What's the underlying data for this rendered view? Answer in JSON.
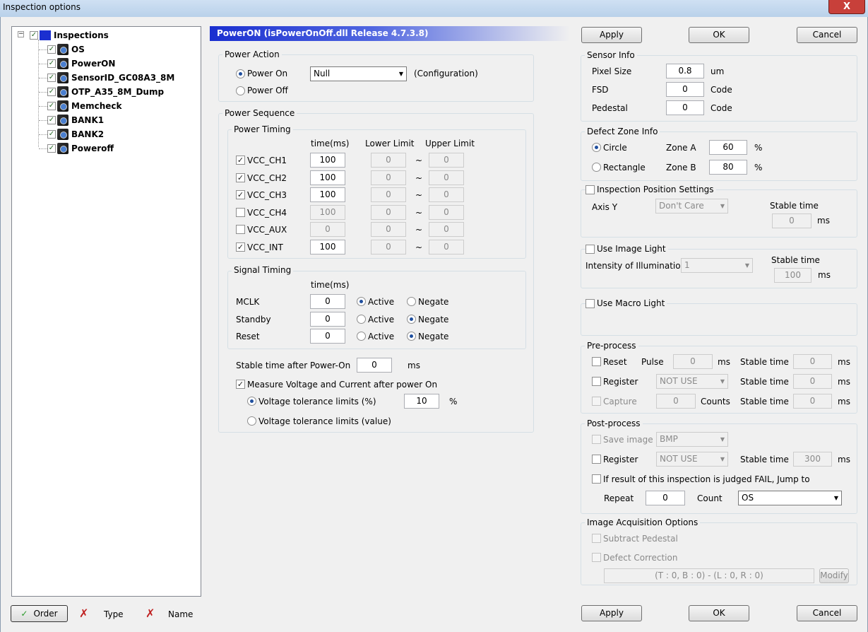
{
  "window": {
    "title": "Inspection options",
    "close": "X"
  },
  "tree": {
    "root": "Inspections",
    "items": [
      "OS",
      "PowerON",
      "SensorID_GC08A3_8M",
      "OTP_A35_8M_Dump",
      "Memcheck",
      "BANK1",
      "BANK2",
      "Poweroff"
    ]
  },
  "bottom": {
    "order": "Order",
    "type": "Type",
    "name": "Name"
  },
  "header": {
    "text": "PowerON  (isPowerOnOff.dll   Release 4.7.3.8)"
  },
  "buttons": {
    "apply": "Apply",
    "ok": "OK",
    "cancel": "Cancel"
  },
  "power_action": {
    "title": "Power Action",
    "on": "Power On",
    "off": "Power Off",
    "select": "Null",
    "config": "(Configuration)"
  },
  "power_sequence": {
    "title": "Power Sequence",
    "timing_title": "Power Timing",
    "col_time": "time(ms)",
    "col_lower": "Lower Limit",
    "col_upper": "Upper Limit",
    "tilde": "~",
    "rows": [
      {
        "name": "VCC_CH1",
        "time": "100",
        "lower": "0",
        "upper": "0",
        "checked": true
      },
      {
        "name": "VCC_CH2",
        "time": "100",
        "lower": "0",
        "upper": "0",
        "checked": true
      },
      {
        "name": "VCC_CH3",
        "time": "100",
        "lower": "0",
        "upper": "0",
        "checked": true
      },
      {
        "name": "VCC_CH4",
        "time": "100",
        "lower": "0",
        "upper": "0",
        "checked": false
      },
      {
        "name": "VCC_AUX",
        "time": "0",
        "lower": "0",
        "upper": "0",
        "checked": false
      },
      {
        "name": "VCC_INT",
        "time": "100",
        "lower": "0",
        "upper": "0",
        "checked": true
      }
    ],
    "signal_title": "Signal Timing",
    "sig_col": "time(ms)",
    "active": "Active",
    "negate": "Negate",
    "signals": [
      {
        "name": "MCLK",
        "time": "0"
      },
      {
        "name": "Standby",
        "time": "0"
      },
      {
        "name": "Reset",
        "time": "0"
      }
    ],
    "stable_label": "Stable time after Power-On",
    "stable_value": "0",
    "ms": "ms",
    "measure": "Measure Voltage and Current after power On",
    "tol_pct": "Voltage tolerance limits (%)",
    "tol_pct_value": "10",
    "pct": "%",
    "tol_val": "Voltage tolerance limits (value)"
  },
  "sensor_info": {
    "title": "Sensor Info",
    "pixel": "Pixel Size",
    "pixel_val": "0.8",
    "pixel_unit": "um",
    "fsd": "FSD",
    "fsd_val": "0",
    "fsd_unit": "Code",
    "ped": "Pedestal",
    "ped_val": "0",
    "ped_unit": "Code"
  },
  "defect_zone": {
    "title": "Defect Zone Info",
    "circle": "Circle",
    "rect": "Rectangle",
    "za": "Zone A",
    "za_val": "60",
    "zb": "Zone B",
    "zb_val": "80",
    "pct": "%"
  },
  "insp_pos": {
    "title": "Inspection Position Settings",
    "axis": "Axis Y",
    "axis_val": "Don't Care",
    "stable": "Stable time",
    "stable_val": "0",
    "ms": "ms"
  },
  "image_light": {
    "title": "Use Image Light",
    "intensity": "Intensity of Illumination",
    "intensity_val": "1",
    "stable": "Stable time",
    "stable_val": "100",
    "ms": "ms"
  },
  "macro_light": {
    "title": "Use Macro Light"
  },
  "pre": {
    "title": "Pre-process",
    "reset": "Reset",
    "pulse": "Pulse",
    "pulse_val": "0",
    "ms": "ms",
    "stable": "Stable time",
    "reset_stable": "0",
    "register": "Register",
    "reg_val": "NOT USE",
    "reg_stable": "0",
    "capture": "Capture",
    "cap_val": "0",
    "counts": "Counts",
    "cap_stable": "0"
  },
  "post": {
    "title": "Post-process",
    "save": "Save image",
    "save_val": "BMP",
    "register": "Register",
    "reg_val": "NOT USE",
    "stable": "Stable time",
    "reg_stable": "300",
    "ms": "ms",
    "fail": "If result of this inspection is judged FAIL, Jump to",
    "repeat": "Repeat",
    "repeat_val": "0",
    "count": "Count",
    "jump": "OS"
  },
  "acq": {
    "title": "Image Acquisition Options",
    "subtract": "Subtract Pedestal",
    "defect": "Defect Correction",
    "rect": "(T : 0, B : 0) - (L : 0, R : 0)",
    "modify": "Modify"
  }
}
